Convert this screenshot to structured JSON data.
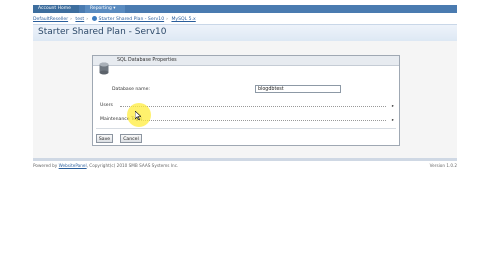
{
  "nav": {
    "home_label": "Account Home",
    "reporting_label": "Reporting ▾"
  },
  "breadcrumb": {
    "items": [
      "DefaultReseller",
      "test",
      "Starter Shared Plan - Serv10",
      "MySQL 5.x"
    ]
  },
  "page": {
    "title": "Starter Shared Plan - Serv10"
  },
  "dialog": {
    "title": "SQL Database Properties",
    "database_label": "Database name:",
    "database_value": "blogdbtest",
    "users_label": "Users",
    "maintenance_label": "Maintenance Tools",
    "save_label": "Save",
    "cancel_label": "Cancel"
  },
  "footer": {
    "prefix": "Powered by",
    "link": "WebsitePanel",
    "rest": ", Copyright(c) 2010 SMB SAAS Systems Inc.",
    "version": "Version 1.0.2"
  }
}
